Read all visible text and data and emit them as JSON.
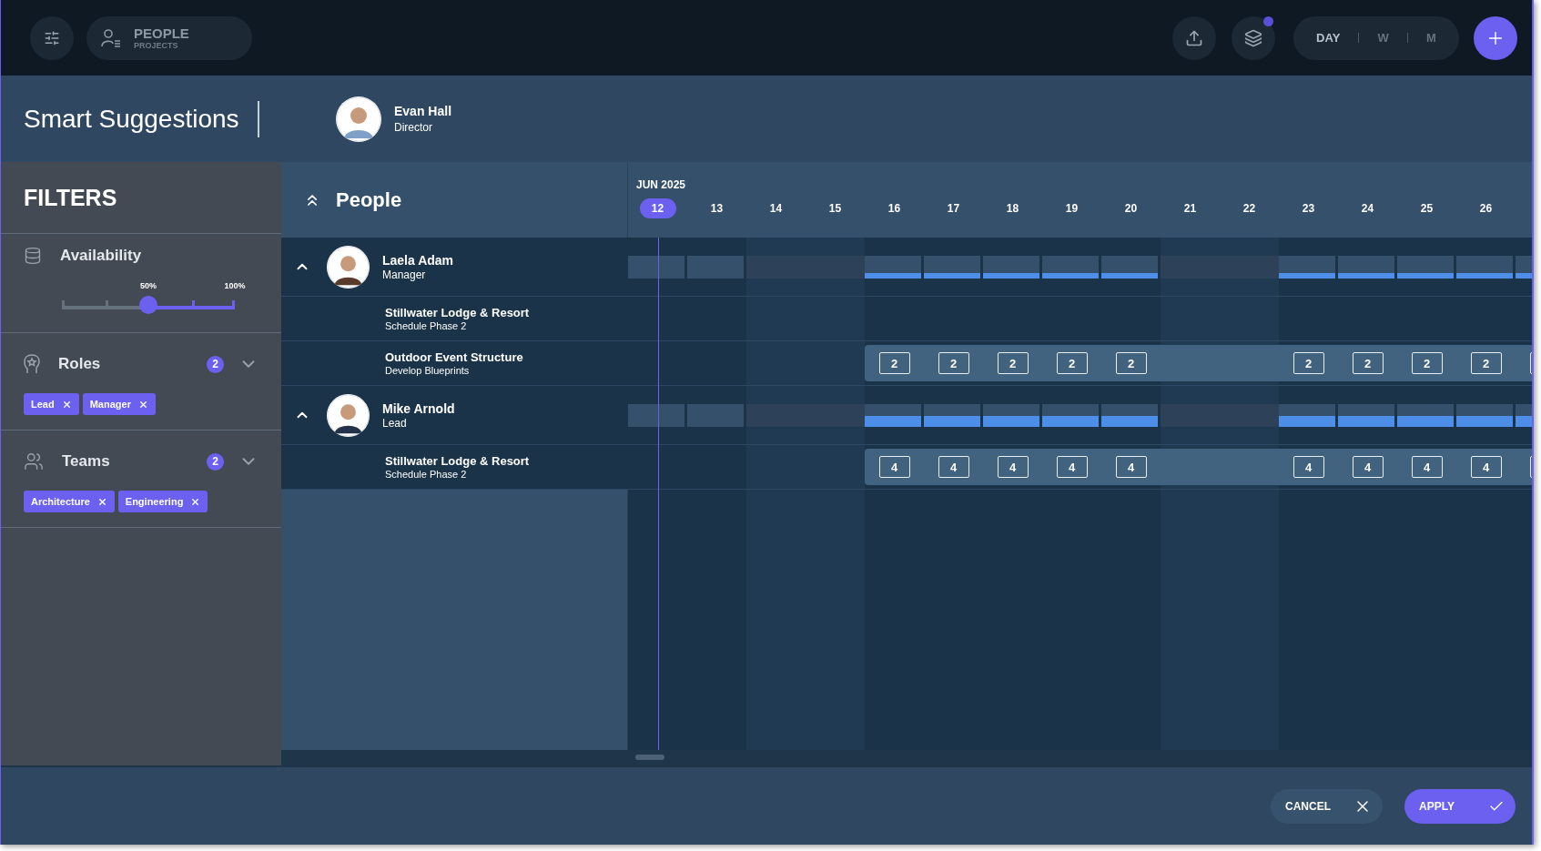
{
  "topbar": {
    "view_switcher": {
      "title": "PEOPLE",
      "subtitle": "PROJECTS"
    },
    "layers_notification": true,
    "scale_tabs": [
      {
        "label": "DAY",
        "selected": true
      },
      {
        "label": "W",
        "selected": false
      },
      {
        "label": "M",
        "selected": false
      }
    ]
  },
  "dialog": {
    "title": "Smart Suggestions",
    "person": {
      "name": "Evan Hall",
      "role": "Director"
    }
  },
  "filters": {
    "title": "FILTERS",
    "availability": {
      "label": "Availability",
      "level": 0.5,
      "value_label": "50%",
      "max_label": "100%"
    },
    "groups": [
      {
        "kind": "roles",
        "label": "Roles",
        "count": "2",
        "expanded": false,
        "chips": [
          "Lead",
          "Manager"
        ]
      },
      {
        "kind": "teams",
        "label": "Teams",
        "count": "2",
        "expanded": false,
        "chips": [
          "Architecture",
          "Engineering"
        ]
      }
    ]
  },
  "people_header": {
    "title": "People"
  },
  "timeline": {
    "month": "JUN 2025",
    "days": [
      {
        "label": "12",
        "selected": true,
        "kind": "weekday"
      },
      {
        "label": "13",
        "selected": false,
        "kind": "weekday"
      },
      {
        "label": "14",
        "selected": false,
        "kind": "weekend"
      },
      {
        "label": "15",
        "selected": false,
        "kind": "weekend"
      },
      {
        "label": "16",
        "selected": false,
        "kind": "weekday"
      },
      {
        "label": "17",
        "selected": false,
        "kind": "weekday"
      },
      {
        "label": "18",
        "selected": false,
        "kind": "weekday"
      },
      {
        "label": "19",
        "selected": false,
        "kind": "weekday"
      },
      {
        "label": "20",
        "selected": false,
        "kind": "weekday"
      },
      {
        "label": "21",
        "selected": false,
        "kind": "weekend"
      },
      {
        "label": "22",
        "selected": false,
        "kind": "weekend"
      },
      {
        "label": "23",
        "selected": false,
        "kind": "weekday"
      },
      {
        "label": "24",
        "selected": false,
        "kind": "weekday"
      },
      {
        "label": "25",
        "selected": false,
        "kind": "weekday"
      },
      {
        "label": "26",
        "selected": false,
        "kind": "weekday"
      }
    ]
  },
  "people": [
    {
      "name": "Laela Adam",
      "role": "Manager",
      "expanded": true,
      "cells": [
        {
          "kind": "idle"
        },
        {
          "kind": "idle"
        },
        {
          "kind": "off"
        },
        {
          "kind": "off"
        },
        {
          "kind": "light"
        },
        {
          "kind": "light"
        },
        {
          "kind": "light"
        },
        {
          "kind": "light"
        },
        {
          "kind": "light"
        },
        {
          "kind": "off"
        },
        {
          "kind": "off"
        },
        {
          "kind": "light"
        },
        {
          "kind": "light"
        },
        {
          "kind": "light"
        },
        {
          "kind": "light"
        },
        {
          "kind": "light"
        }
      ],
      "projects": [
        {
          "name": "Stillwater Lodge & Resort",
          "task": "Schedule Phase 2",
          "cells": [
            {
              "kind": "empty"
            },
            {
              "kind": "empty"
            },
            {
              "kind": "empty"
            },
            {
              "kind": "empty"
            },
            {
              "kind": "empty"
            },
            {
              "kind": "empty"
            },
            {
              "kind": "empty"
            },
            {
              "kind": "empty"
            },
            {
              "kind": "empty"
            },
            {
              "kind": "empty"
            },
            {
              "kind": "empty"
            },
            {
              "kind": "empty"
            },
            {
              "kind": "empty"
            },
            {
              "kind": "empty"
            },
            {
              "kind": "empty"
            },
            {
              "kind": "empty"
            }
          ]
        },
        {
          "name": "Outdoor Event Structure",
          "task": "Develop Blueprints",
          "cells": [
            {
              "kind": "empty"
            },
            {
              "kind": "empty"
            },
            {
              "kind": "empty"
            },
            {
              "kind": "empty"
            },
            {
              "kind": "hours",
              "value": "2"
            },
            {
              "kind": "hours",
              "value": "2"
            },
            {
              "kind": "hours",
              "value": "2"
            },
            {
              "kind": "hours",
              "value": "2"
            },
            {
              "kind": "hours",
              "value": "2"
            },
            {
              "kind": "gap"
            },
            {
              "kind": "gap"
            },
            {
              "kind": "hours",
              "value": "2"
            },
            {
              "kind": "hours",
              "value": "2"
            },
            {
              "kind": "hours",
              "value": "2"
            },
            {
              "kind": "hours",
              "value": "2"
            },
            {
              "kind": "edge"
            }
          ]
        }
      ]
    },
    {
      "name": "Mike Arnold",
      "role": "Lead",
      "expanded": true,
      "cells": [
        {
          "kind": "idle"
        },
        {
          "kind": "idle"
        },
        {
          "kind": "off"
        },
        {
          "kind": "off"
        },
        {
          "kind": "heavy"
        },
        {
          "kind": "heavy"
        },
        {
          "kind": "heavy"
        },
        {
          "kind": "heavy"
        },
        {
          "kind": "heavy"
        },
        {
          "kind": "off"
        },
        {
          "kind": "off"
        },
        {
          "kind": "heavy"
        },
        {
          "kind": "heavy"
        },
        {
          "kind": "heavy"
        },
        {
          "kind": "heavy"
        },
        {
          "kind": "heavy"
        }
      ],
      "projects": [
        {
          "name": "Stillwater Lodge & Resort",
          "task": "Schedule Phase 2",
          "cells": [
            {
              "kind": "empty"
            },
            {
              "kind": "empty"
            },
            {
              "kind": "empty"
            },
            {
              "kind": "empty"
            },
            {
              "kind": "hours",
              "value": "4"
            },
            {
              "kind": "hours",
              "value": "4"
            },
            {
              "kind": "hours",
              "value": "4"
            },
            {
              "kind": "hours",
              "value": "4"
            },
            {
              "kind": "hours",
              "value": "4"
            },
            {
              "kind": "gap"
            },
            {
              "kind": "gap"
            },
            {
              "kind": "hours",
              "value": "4"
            },
            {
              "kind": "hours",
              "value": "4"
            },
            {
              "kind": "hours",
              "value": "4"
            },
            {
              "kind": "hours",
              "value": "4"
            },
            {
              "kind": "edge"
            }
          ]
        }
      ]
    }
  ],
  "footer": {
    "buttons": [
      {
        "kind": "cancel",
        "label": "CANCEL"
      },
      {
        "kind": "apply",
        "label": "APPLY"
      }
    ]
  }
}
